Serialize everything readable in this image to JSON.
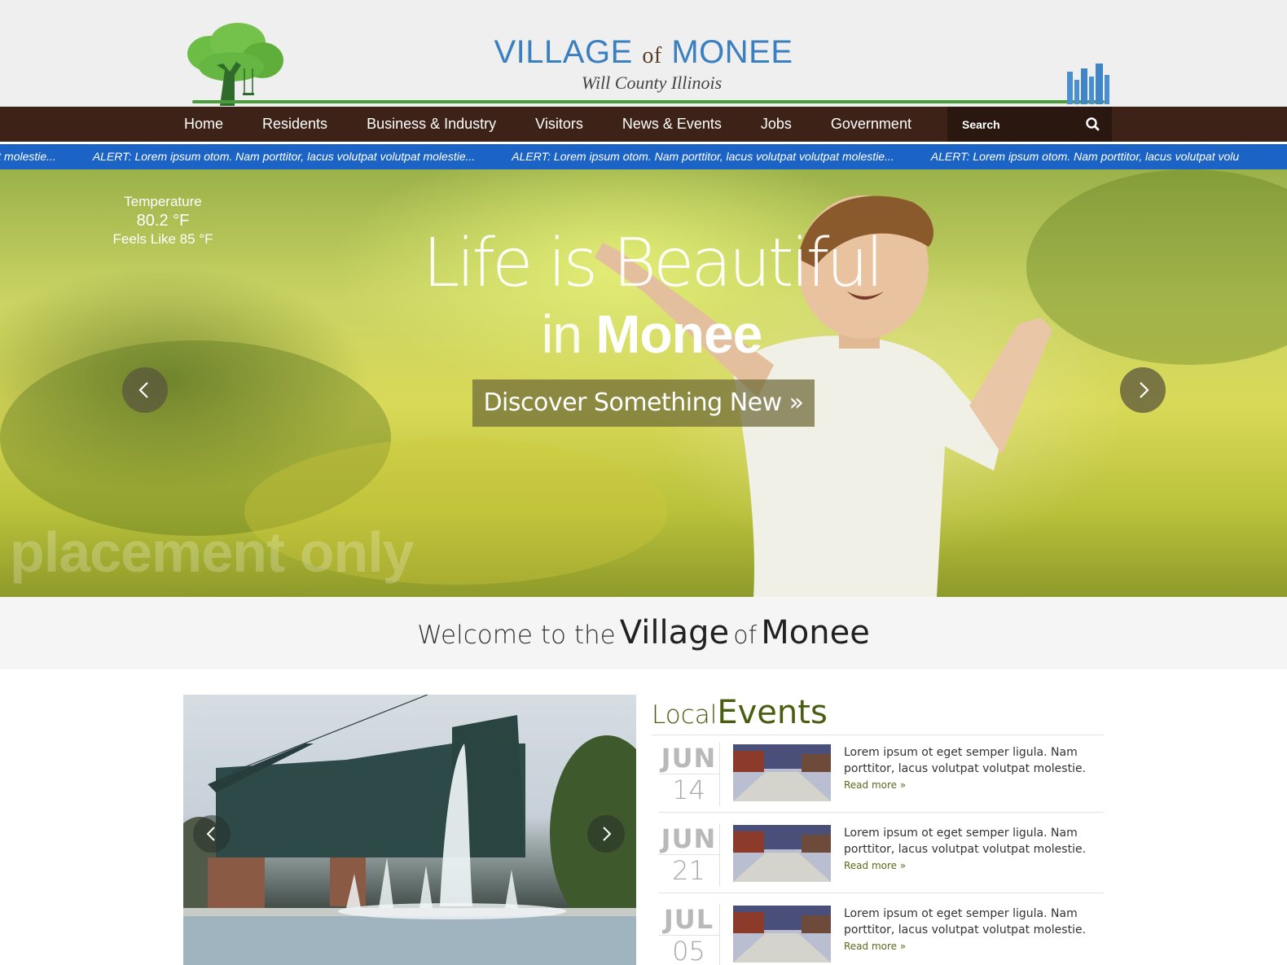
{
  "header": {
    "title_part1": "VILLAGE",
    "title_of": "of",
    "title_part2": "MONEE",
    "subtitle": "Will County Illinois"
  },
  "nav": {
    "items": [
      "Home",
      "Residents",
      "Business & Industry",
      "Visitors",
      "News & Events",
      "Jobs",
      "Government"
    ],
    "search_placeholder": "Search"
  },
  "alert": {
    "items": [
      "utpat molestie...",
      "ALERT: Lorem ipsum otom. Nam porttitor, lacus volutpat volutpat molestie...",
      "ALERT: Lorem ipsum otom. Nam porttitor, lacus volutpat volutpat molestie...",
      "ALERT: Lorem ipsum otom. Nam porttitor, lacus volutpat volu"
    ]
  },
  "hero": {
    "weather": {
      "label": "Temperature",
      "temp": "80.2 °F",
      "feels": "Feels Like 85 °F"
    },
    "title_line1": "Life is Beautiful",
    "title_in": "in",
    "title_place": "Monee",
    "cta": "Discover Something New »",
    "watermark": "placement only"
  },
  "welcome": {
    "part1": "Welcome to the",
    "part2": "Village",
    "part3": "of",
    "part4": "Monee"
  },
  "events": {
    "title_local": "Local",
    "title_events": "Events",
    "items": [
      {
        "month": "JUN",
        "day": "14",
        "text": "Lorem ipsum ot eget semper ligula. Nam porttitor, lacus volutpat volutpat molestie.",
        "more": "Read more »"
      },
      {
        "month": "JUN",
        "day": "21",
        "text": "Lorem ipsum ot eget semper ligula. Nam porttitor, lacus volutpat volutpat molestie.",
        "more": "Read more »"
      },
      {
        "month": "JUL",
        "day": "05",
        "text": "Lorem ipsum ot eget semper ligula. Nam porttitor, lacus volutpat volutpat molestie.",
        "more": "Read more »"
      }
    ]
  },
  "colors": {
    "nav_bg": "#3d2217",
    "alert_bg": "#1c63c6",
    "brand_blue": "#3a7fc0",
    "events_green": "#4a5e12"
  },
  "icons": {
    "logo": "tree-logo-icon",
    "skyline": "skyline-icon",
    "search": "search-icon",
    "prev": "chevron-left-icon",
    "next": "chevron-right-icon"
  }
}
